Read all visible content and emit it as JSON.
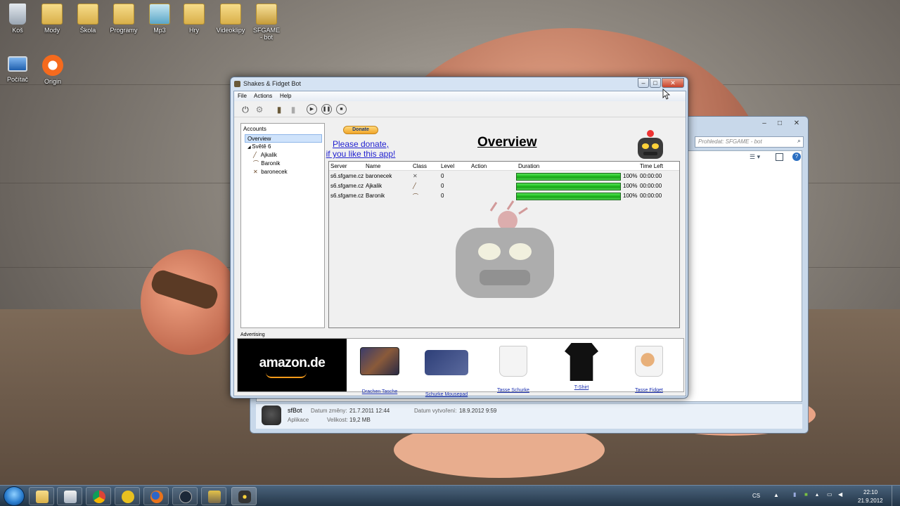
{
  "desktop": {
    "icons": [
      {
        "label": "Koš",
        "icon": "recycle-bin-icon"
      },
      {
        "label": "Mody",
        "icon": "folder-icon"
      },
      {
        "label": "Škola",
        "icon": "folder-icon"
      },
      {
        "label": "Programy",
        "icon": "folder-icon"
      },
      {
        "label": "Mp3",
        "icon": "folder-icon"
      },
      {
        "label": "Hry",
        "icon": "folder-icon"
      },
      {
        "label": "Videoklipy",
        "icon": "folder-icon"
      },
      {
        "label": "SFGAME - bot",
        "icon": "folder-icon"
      },
      {
        "label": "Počítač",
        "icon": "computer-icon"
      },
      {
        "label": "Origin",
        "icon": "origin-icon"
      }
    ]
  },
  "explorer": {
    "search_placeholder": "Prohledat: SFGAME - bot",
    "details": {
      "name": "sfBot",
      "type": "Aplikace",
      "modified_label": "Datum změny:",
      "modified_value": "21.7.2011 12:44",
      "created_label": "Datum vytvoření:",
      "created_value": "18.9.2012 9:59",
      "size_label": "Velikost:",
      "size_value": "19,2 MB"
    }
  },
  "app": {
    "title": "Shakes & Fidget Bot",
    "menu": [
      "File",
      "Actions",
      "Help"
    ],
    "accounts": {
      "header": "Accounts",
      "overview": "Overview",
      "world": "Světě 6",
      "characters": [
        "Ajkalik",
        "Baronik",
        "baronecek"
      ]
    },
    "donate_button": "Donate",
    "donate_text_1": "Please donate,",
    "donate_text_2": "if you like this app!",
    "overview_title": "Overview",
    "grid": {
      "columns": [
        "Server",
        "Name",
        "Class",
        "Level",
        "Action",
        "Duration",
        "Time Left"
      ],
      "rows": [
        {
          "server": "s6.sfgame.cz",
          "name": "baronecek",
          "class_icon": "sword-icon",
          "level": "0",
          "action": "",
          "progress": 100,
          "percent": "100%",
          "time_left": "00:00:00"
        },
        {
          "server": "s6.sfgame.cz",
          "name": "Ajkalik",
          "class_icon": "staff-icon",
          "level": "0",
          "action": "",
          "progress": 100,
          "percent": "100%",
          "time_left": "00:00:00"
        },
        {
          "server": "s6.sfgame.cz",
          "name": "Baronik",
          "class_icon": "bow-icon",
          "level": "0",
          "action": "",
          "progress": 100,
          "percent": "100%",
          "time_left": "00:00:00"
        }
      ]
    },
    "advertising": {
      "label": "Advertising",
      "brand": "amazon.de",
      "products": [
        "Drachen Tasche",
        "Schurke Mousepad",
        "Tasse Schurke",
        "T-Shirt",
        "Tasse Fidget"
      ]
    }
  },
  "taskbar": {
    "language": "CS",
    "time": "22:10",
    "date": "21.9.2012"
  }
}
